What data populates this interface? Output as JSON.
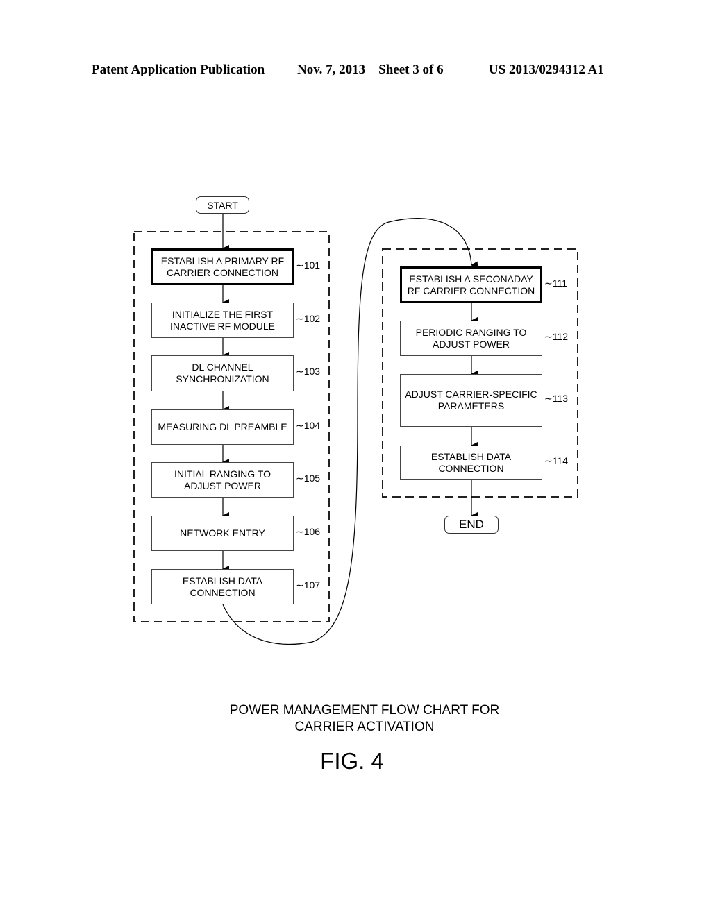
{
  "header": {
    "publication": "Patent Application Publication",
    "date_sheet": "Nov. 7, 2013    Sheet 3 of 6",
    "number": "US 2013/0294312 A1"
  },
  "flowchart": {
    "start_label": "START",
    "end_label": "END",
    "primary_group": [
      {
        "text": "ESTABLISH A PRIMARY RF CARRIER CONNECTION",
        "ref": "101",
        "emphasized": true
      },
      {
        "text": "INITIALIZE THE FIRST INACTIVE RF MODULE",
        "ref": "102"
      },
      {
        "text": "DL CHANNEL SYNCHRONIZATION",
        "ref": "103"
      },
      {
        "text": "MEASURING DL PREAMBLE",
        "ref": "104"
      },
      {
        "text": "INITIAL RANGING TO ADJUST POWER",
        "ref": "105"
      },
      {
        "text": "NETWORK ENTRY",
        "ref": "106"
      },
      {
        "text": "ESTABLISH DATA CONNECTION",
        "ref": "107"
      }
    ],
    "secondary_group": [
      {
        "text": "ESTABLISH A SECONADAY RF CARRIER CONNECTION",
        "ref": "111",
        "emphasized": true
      },
      {
        "text": "PERIODIC RANGING TO ADJUST POWER",
        "ref": "112"
      },
      {
        "text": "ADJUST CARRIER-SPECIFIC PARAMETERS",
        "ref": "113"
      },
      {
        "text": "ESTABLISH DATA CONNECTION",
        "ref": "114"
      }
    ]
  },
  "caption": {
    "line1": "POWER MANAGEMENT FLOW CHART FOR",
    "line2": "CARRIER ACTIVATION",
    "figure": "FIG. 4"
  }
}
